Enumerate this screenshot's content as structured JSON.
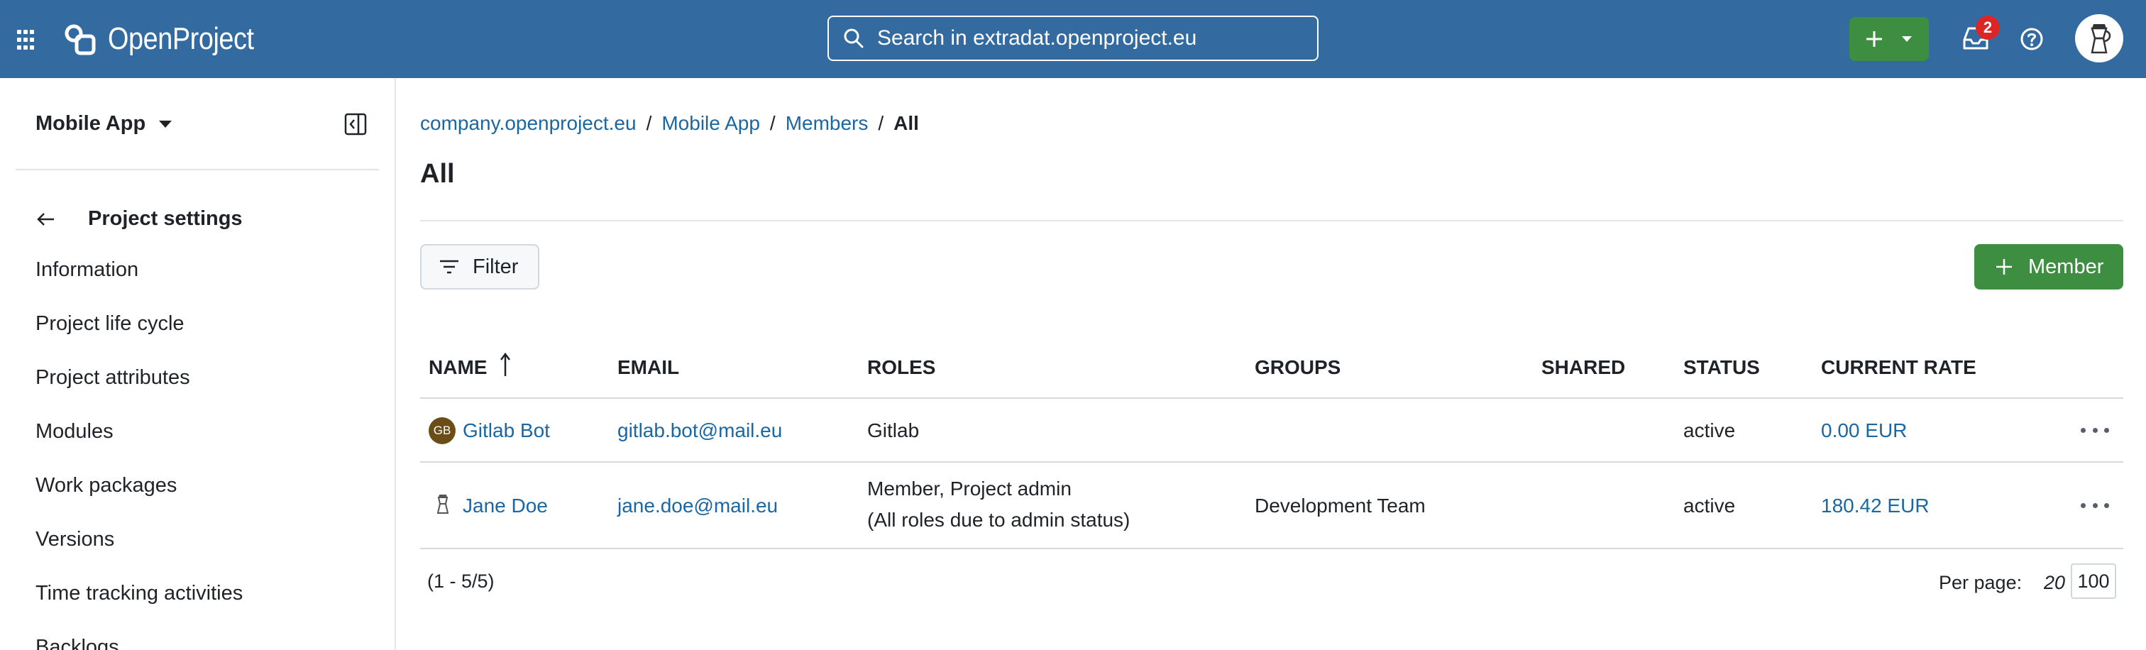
{
  "header": {
    "logo_text": "OpenProject",
    "search_placeholder": "Search in extradat.openproject.eu",
    "notification_count": "2"
  },
  "sidebar": {
    "project_name": "Mobile App",
    "section_title": "Project settings",
    "items": [
      {
        "label": "Information"
      },
      {
        "label": "Project life cycle"
      },
      {
        "label": "Project attributes"
      },
      {
        "label": "Modules"
      },
      {
        "label": "Work packages"
      },
      {
        "label": "Versions"
      },
      {
        "label": "Time tracking activities"
      },
      {
        "label": "Backlogs"
      }
    ]
  },
  "breadcrumb": {
    "items": [
      "company.openproject.eu",
      "Mobile App",
      "Members"
    ],
    "current": "All",
    "separator": "/"
  },
  "page": {
    "title": "All",
    "filter_label": "Filter",
    "add_member_label": "Member"
  },
  "table": {
    "columns": {
      "name": "NAME",
      "email": "EMAIL",
      "roles": "ROLES",
      "groups": "GROUPS",
      "shared": "SHARED",
      "status": "STATUS",
      "rate": "CURRENT RATE"
    },
    "rows": [
      {
        "avatar_initials": "GB",
        "name": "Gitlab Bot",
        "email": "gitlab.bot@mail.eu",
        "roles": "Gitlab",
        "roles_note": "",
        "groups": "",
        "shared": "",
        "status": "active",
        "rate": "0.00 EUR"
      },
      {
        "avatar_initials": "",
        "name": "Jane Doe",
        "email": "jane.doe@mail.eu",
        "roles": "Member, Project admin",
        "roles_note": "(All roles due to admin status)",
        "groups": "Development Team",
        "shared": "",
        "status": "active",
        "rate": "180.42 EUR"
      }
    ]
  },
  "pagination": {
    "range": "(1 - 5/5)",
    "per_page_label": "Per page:",
    "options": [
      "20",
      "100"
    ]
  },
  "colors": {
    "header_bg": "#336ba1",
    "primary_green": "#3e8e41",
    "link": "#1a67a3",
    "badge": "#dc2626"
  }
}
